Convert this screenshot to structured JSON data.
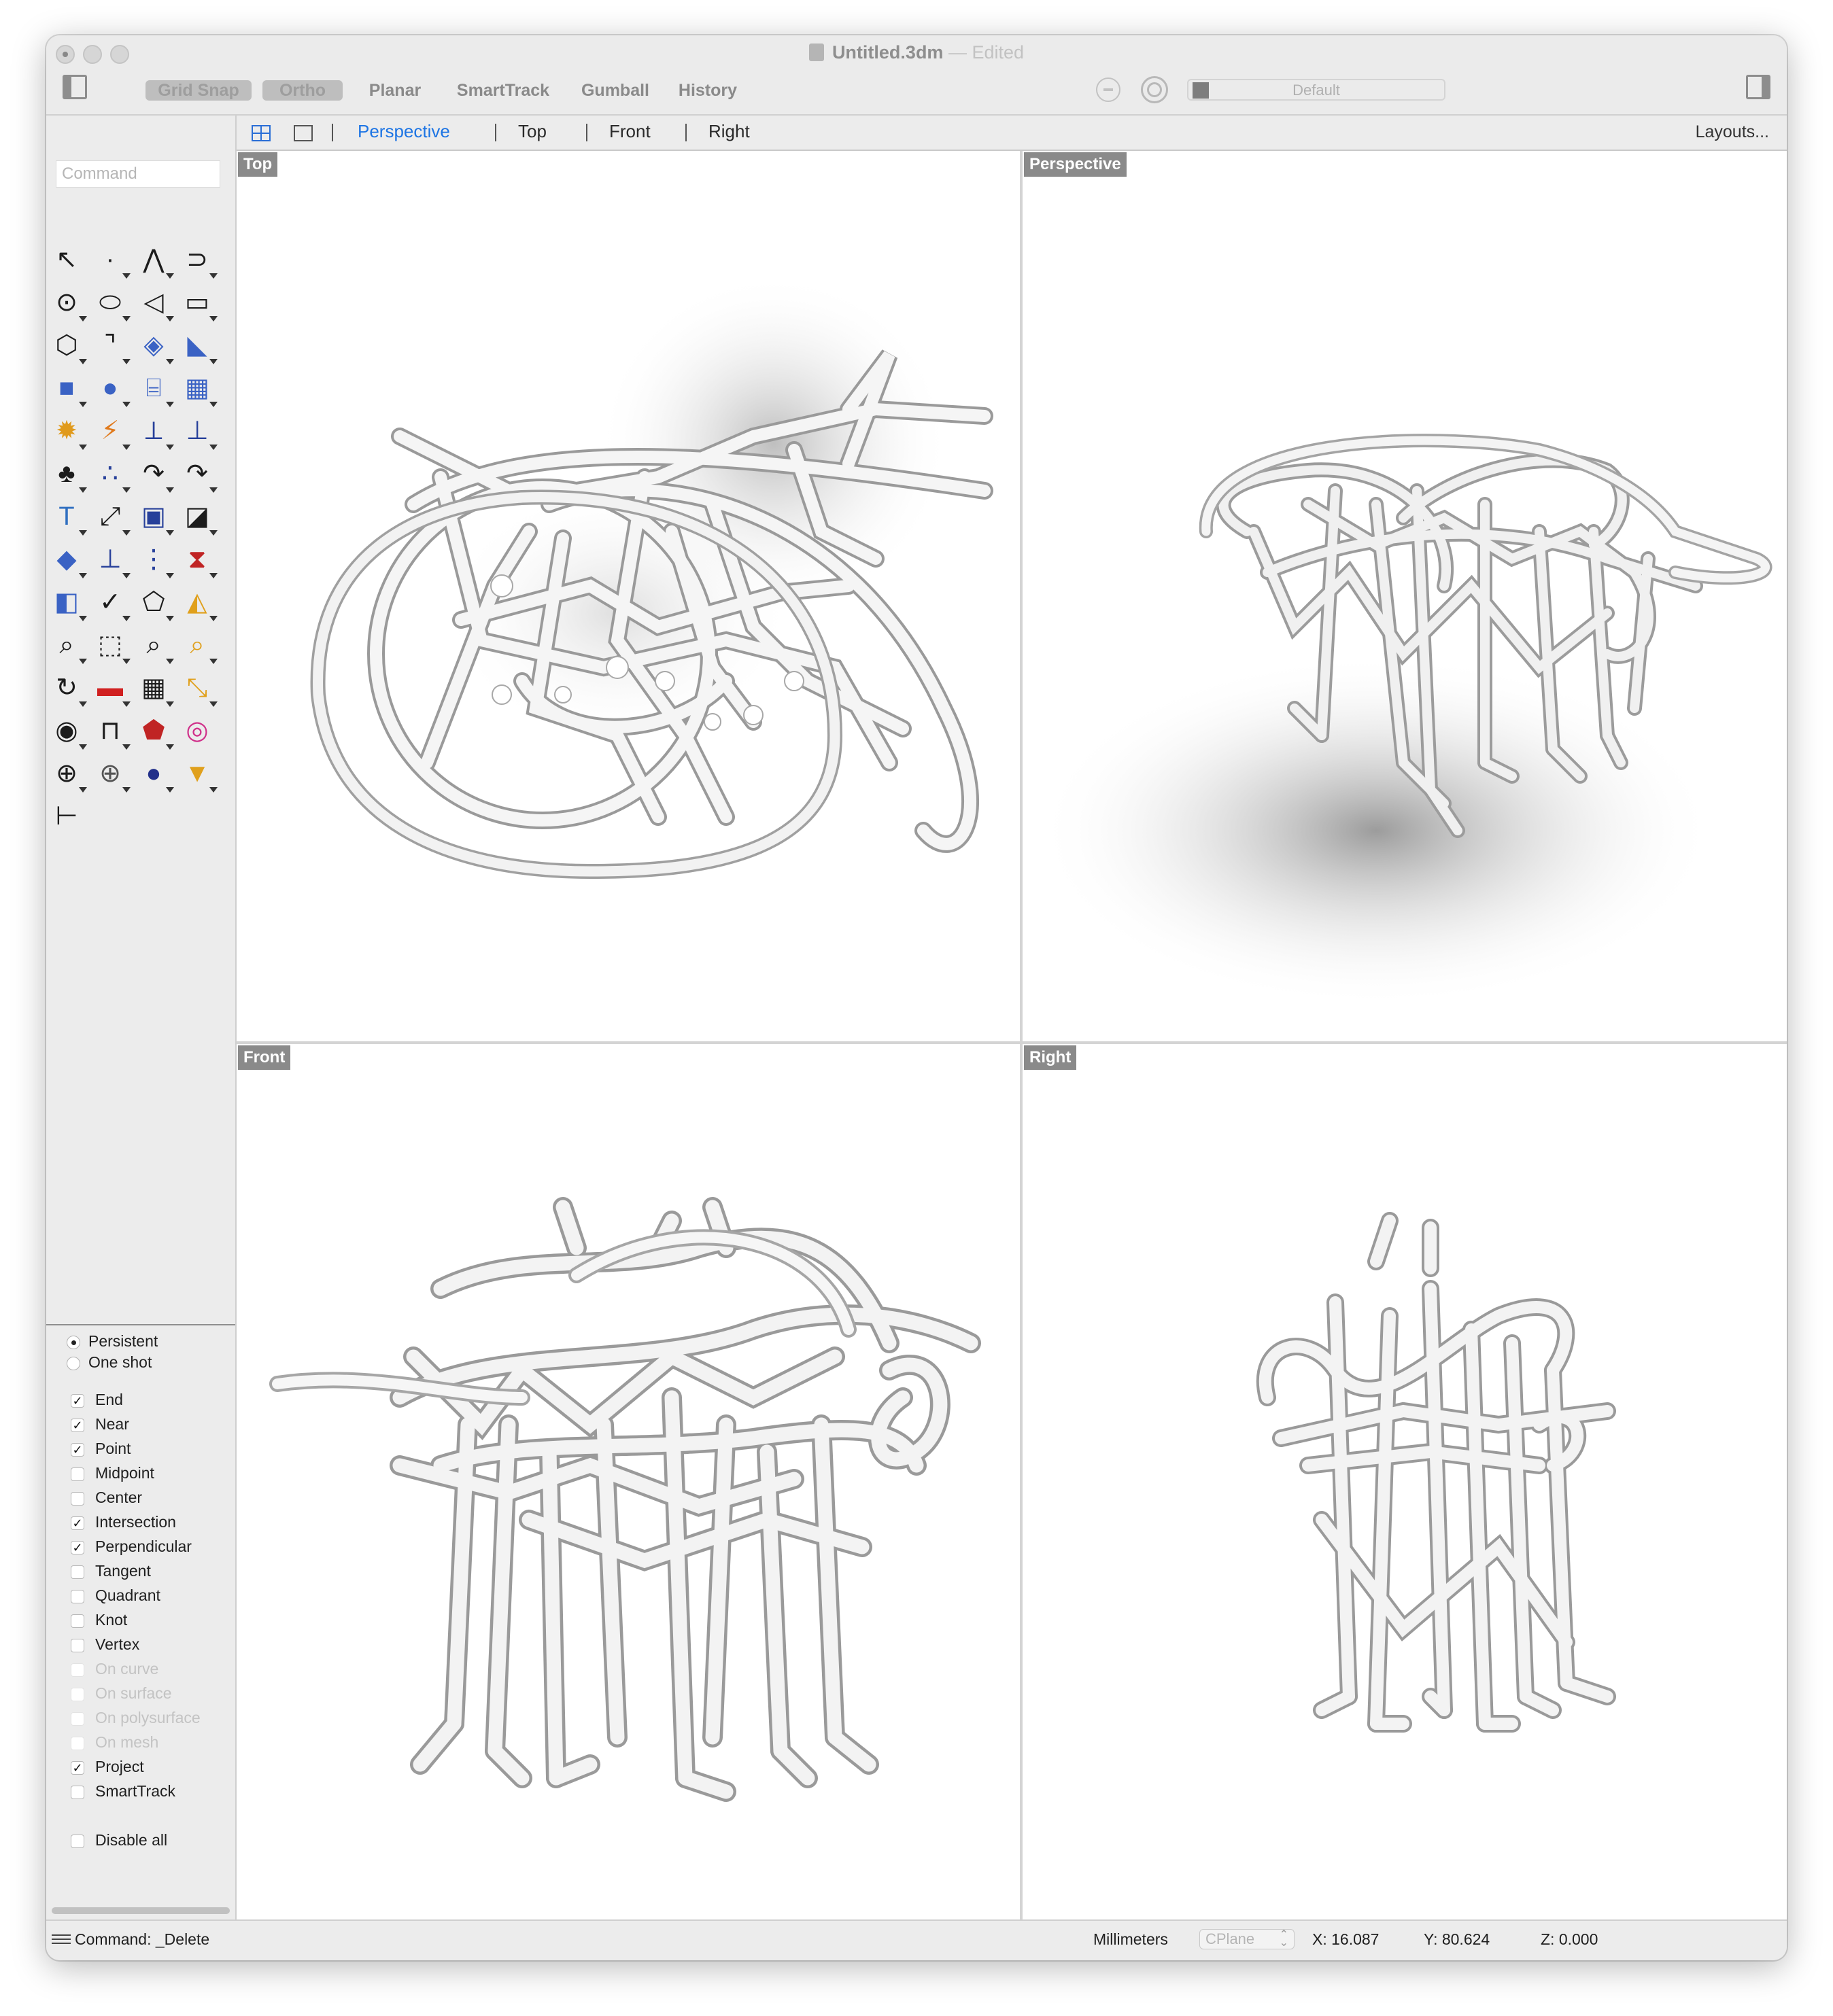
{
  "window": {
    "title": "Untitled.3dm",
    "title_separator": "—",
    "title_status": "Edited"
  },
  "modes": [
    {
      "label": "Grid Snap",
      "active": true
    },
    {
      "label": "Ortho",
      "active": true
    },
    {
      "label": "Planar",
      "active": false
    },
    {
      "label": "SmartTrack",
      "active": false
    },
    {
      "label": "Gumball",
      "active": false
    },
    {
      "label": "History",
      "active": false
    }
  ],
  "layer": {
    "name": "Default",
    "color": "#7d7d7d"
  },
  "command": {
    "placeholder": "Command"
  },
  "viewport_tabs": {
    "tabs": [
      "Perspective",
      "Top",
      "Front",
      "Right"
    ],
    "active": "Perspective",
    "layouts_label": "Layouts..."
  },
  "viewports": {
    "top": {
      "label": "Top"
    },
    "perspective": {
      "label": "Perspective"
    },
    "front": {
      "label": "Front"
    },
    "right": {
      "label": "Right"
    }
  },
  "toolbox": [
    {
      "name": "select-arrow-icon",
      "glyph": "↖",
      "color": "#1c1c1c",
      "flyout": false
    },
    {
      "name": "point-icon",
      "glyph": "·",
      "color": "#1c1c1c",
      "flyout": true
    },
    {
      "name": "polyline-icon",
      "glyph": "⋀",
      "color": "#1c1c1c",
      "flyout": true
    },
    {
      "name": "curve-icon",
      "glyph": "⊃",
      "color": "#1c1c1c",
      "flyout": true
    },
    {
      "name": "circle-icon",
      "glyph": "⊙",
      "color": "#1c1c1c",
      "flyout": true
    },
    {
      "name": "ellipse-icon",
      "glyph": "⬭",
      "color": "#1c1c1c",
      "flyout": true
    },
    {
      "name": "arc-icon",
      "glyph": "◁",
      "color": "#1c1c1c",
      "flyout": true
    },
    {
      "name": "rectangle-icon",
      "glyph": "▭",
      "color": "#1c1c1c",
      "flyout": true
    },
    {
      "name": "polygon-icon",
      "glyph": "⬡",
      "color": "#1c1c1c",
      "flyout": true
    },
    {
      "name": "fillet-icon",
      "glyph": "⌝",
      "color": "#1c1c1c",
      "flyout": true
    },
    {
      "name": "surface-icon",
      "glyph": "◈",
      "color": "#3a62c4",
      "flyout": true
    },
    {
      "name": "extrude-surface-icon",
      "glyph": "◣",
      "color": "#3a62c4",
      "flyout": true
    },
    {
      "name": "box-icon",
      "glyph": "■",
      "color": "#3a62c4",
      "flyout": true
    },
    {
      "name": "boolean-icon",
      "glyph": "●",
      "color": "#3a62c4",
      "flyout": true
    },
    {
      "name": "cylinder-icon",
      "glyph": "⌸",
      "color": "#3a62c4",
      "flyout": true
    },
    {
      "name": "mesh-icon",
      "glyph": "▦",
      "color": "#3a62c4",
      "flyout": true
    },
    {
      "name": "explode-icon",
      "glyph": "✹",
      "color": "#e09a1c",
      "flyout": true
    },
    {
      "name": "split-icon",
      "glyph": "⚡",
      "color": "#e07a1c",
      "flyout": true
    },
    {
      "name": "trim-icon",
      "glyph": "⟂",
      "color": "#27409a",
      "flyout": true
    },
    {
      "name": "split-plane-icon",
      "glyph": "⊥",
      "color": "#27409a",
      "flyout": true
    },
    {
      "name": "solid-tools-icon",
      "glyph": "♣",
      "color": "#1c1c1c",
      "flyout": true
    },
    {
      "name": "points-on-icon",
      "glyph": "∴",
      "color": "#27409a",
      "flyout": true
    },
    {
      "name": "rebuild-curve-icon",
      "glyph": "↷",
      "color": "#1c1c1c",
      "flyout": true
    },
    {
      "name": "edit-points-icon",
      "glyph": "↷",
      "color": "#1c1c1c",
      "flyout": true
    },
    {
      "name": "text-icon",
      "glyph": "T",
      "color": "#2f6fc0",
      "flyout": true
    },
    {
      "name": "scale-icon",
      "glyph": "⤢",
      "color": "#1c1c1c",
      "flyout": true
    },
    {
      "name": "group-icon",
      "glyph": "▣",
      "color": "#27409a",
      "flyout": true
    },
    {
      "name": "tag-icon",
      "glyph": "◪",
      "color": "#1c1c1c",
      "flyout": true
    },
    {
      "name": "block-icon",
      "glyph": "◆",
      "color": "#3a62c4",
      "flyout": true
    },
    {
      "name": "dimension-icon",
      "glyph": "⊥",
      "color": "#27409a",
      "flyout": true
    },
    {
      "name": "array-icon",
      "glyph": "⋮",
      "color": "#27409a",
      "flyout": true
    },
    {
      "name": "transform-icon",
      "glyph": "⧗",
      "color": "#c02424",
      "flyout": true
    },
    {
      "name": "analyze-icon",
      "glyph": "◧",
      "color": "#3a62c4",
      "flyout": true
    },
    {
      "name": "check-icon",
      "glyph": "✓",
      "color": "#1c1c1c",
      "flyout": true
    },
    {
      "name": "unroll-icon",
      "glyph": "⬠",
      "color": "#1c1c1c",
      "flyout": true
    },
    {
      "name": "make2d-icon",
      "glyph": "◭",
      "color": "#e0a01c",
      "flyout": true
    },
    {
      "name": "zoom-icon",
      "glyph": "⌕",
      "color": "#1c1c1c",
      "flyout": true
    },
    {
      "name": "zoom-window-icon",
      "glyph": "⬚",
      "color": "#1c1c1c",
      "flyout": true
    },
    {
      "name": "zoom-extents-icon",
      "glyph": "⌕",
      "color": "#1c1c1c",
      "flyout": true
    },
    {
      "name": "zoom-selected-icon",
      "glyph": "⌕",
      "color": "#e0a01c",
      "flyout": true
    },
    {
      "name": "rotate-view-icon",
      "glyph": "↻",
      "color": "#1c1c1c",
      "flyout": true
    },
    {
      "name": "named-view-icon",
      "glyph": "▬",
      "color": "#d02020",
      "flyout": true
    },
    {
      "name": "cplane-icon",
      "glyph": "▦",
      "color": "#1c1c1c",
      "flyout": true
    },
    {
      "name": "set-view-icon",
      "glyph": "⤡",
      "color": "#e0a01c",
      "flyout": true
    },
    {
      "name": "light-icon",
      "glyph": "◉",
      "color": "#1c1c1c",
      "flyout": true
    },
    {
      "name": "lock-icon",
      "glyph": "⊓",
      "color": "#1c1c1c",
      "flyout": true
    },
    {
      "name": "render-icon",
      "glyph": "⬟",
      "color": "#c02424",
      "flyout": true
    },
    {
      "name": "color-wheel-icon",
      "glyph": "◎",
      "color": "#d0308a",
      "flyout": false
    },
    {
      "name": "wireframe-sphere-icon",
      "glyph": "⊕",
      "color": "#1c1c1c",
      "flyout": true
    },
    {
      "name": "shaded-sphere-icon",
      "glyph": "⊕",
      "color": "#555555",
      "flyout": true
    },
    {
      "name": "rendered-sphere-icon",
      "glyph": "●",
      "color": "#22308a",
      "flyout": true
    },
    {
      "name": "spotlight-icon",
      "glyph": "▼",
      "color": "#e0a01c",
      "flyout": true
    },
    {
      "name": "gumball-icon",
      "glyph": "⊢",
      "color": "#1c1c1c",
      "flyout": false
    }
  ],
  "osnap": {
    "radios": [
      {
        "label": "Persistent",
        "selected": true
      },
      {
        "label": "One shot",
        "selected": false
      }
    ],
    "checks": [
      {
        "label": "End",
        "checked": true,
        "enabled": true
      },
      {
        "label": "Near",
        "checked": true,
        "enabled": true
      },
      {
        "label": "Point",
        "checked": true,
        "enabled": true
      },
      {
        "label": "Midpoint",
        "checked": false,
        "enabled": true
      },
      {
        "label": "Center",
        "checked": false,
        "enabled": true
      },
      {
        "label": "Intersection",
        "checked": true,
        "enabled": true
      },
      {
        "label": "Perpendicular",
        "checked": true,
        "enabled": true
      },
      {
        "label": "Tangent",
        "checked": false,
        "enabled": true
      },
      {
        "label": "Quadrant",
        "checked": false,
        "enabled": true
      },
      {
        "label": "Knot",
        "checked": false,
        "enabled": true
      },
      {
        "label": "Vertex",
        "checked": false,
        "enabled": true
      },
      {
        "label": "On curve",
        "checked": false,
        "enabled": false
      },
      {
        "label": "On surface",
        "checked": false,
        "enabled": false
      },
      {
        "label": "On polysurface",
        "checked": false,
        "enabled": false
      },
      {
        "label": "On mesh",
        "checked": false,
        "enabled": false
      },
      {
        "label": "Project",
        "checked": true,
        "enabled": true
      },
      {
        "label": "SmartTrack",
        "checked": false,
        "enabled": true
      }
    ],
    "disable_all": {
      "label": "Disable all",
      "checked": false
    }
  },
  "status": {
    "command": "Command: _Delete",
    "units": "Millimeters",
    "cplane": "CPlane",
    "x": "X: 16.087",
    "y": "Y: 80.624",
    "z": "Z: 0.000"
  }
}
